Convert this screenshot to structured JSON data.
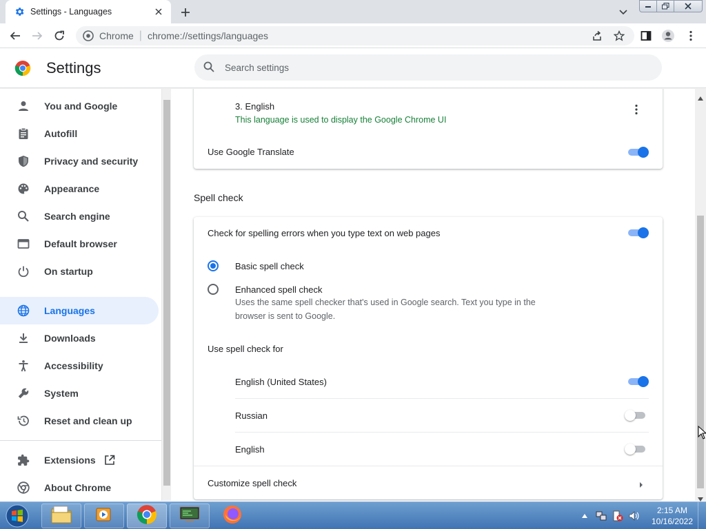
{
  "browser": {
    "tab_title": "Settings - Languages",
    "omnibox_site": "Chrome",
    "omnibox_url": "chrome://settings/languages"
  },
  "header": {
    "title": "Settings",
    "search_placeholder": "Search settings"
  },
  "sidebar": {
    "items": [
      {
        "label": "You and Google",
        "icon": "person-icon"
      },
      {
        "label": "Autofill",
        "icon": "clipboard-icon"
      },
      {
        "label": "Privacy and security",
        "icon": "shield-icon"
      },
      {
        "label": "Appearance",
        "icon": "palette-icon"
      },
      {
        "label": "Search engine",
        "icon": "search-icon"
      },
      {
        "label": "Default browser",
        "icon": "browser-window-icon"
      },
      {
        "label": "On startup",
        "icon": "power-icon"
      },
      {
        "label": "Languages",
        "icon": "globe-icon",
        "active": true
      },
      {
        "label": "Downloads",
        "icon": "download-icon"
      },
      {
        "label": "Accessibility",
        "icon": "accessibility-icon"
      },
      {
        "label": "System",
        "icon": "wrench-icon"
      },
      {
        "label": "Reset and clean up",
        "icon": "history-icon"
      }
    ],
    "extensions_label": "Extensions",
    "about_label": "About Chrome"
  },
  "languages_card": {
    "language_name": "3. English",
    "language_note": "This language is used to display the Google Chrome UI",
    "translate_label": "Use Google Translate",
    "translate_on": true
  },
  "spell_check": {
    "section_title": "Spell check",
    "check_label": "Check for spelling errors when you type text on web pages",
    "check_on": true,
    "basic_label": "Basic spell check",
    "basic_selected": true,
    "enhanced_label": "Enhanced spell check",
    "enhanced_desc": "Uses the same spell checker that's used in Google search. Text you type in the browser is sent to Google.",
    "use_for_label": "Use spell check for",
    "languages": [
      {
        "label": "English (United States)",
        "on": true
      },
      {
        "label": "Russian",
        "on": false
      },
      {
        "label": "English",
        "on": false
      }
    ],
    "customize_label": "Customize spell check"
  },
  "taskbar": {
    "time": "2:15 AM",
    "date": "10/16/2022"
  },
  "colors": {
    "accent": "#1a73e8",
    "language_note": "#188038",
    "active_nav_bg": "#e8f0fe"
  }
}
